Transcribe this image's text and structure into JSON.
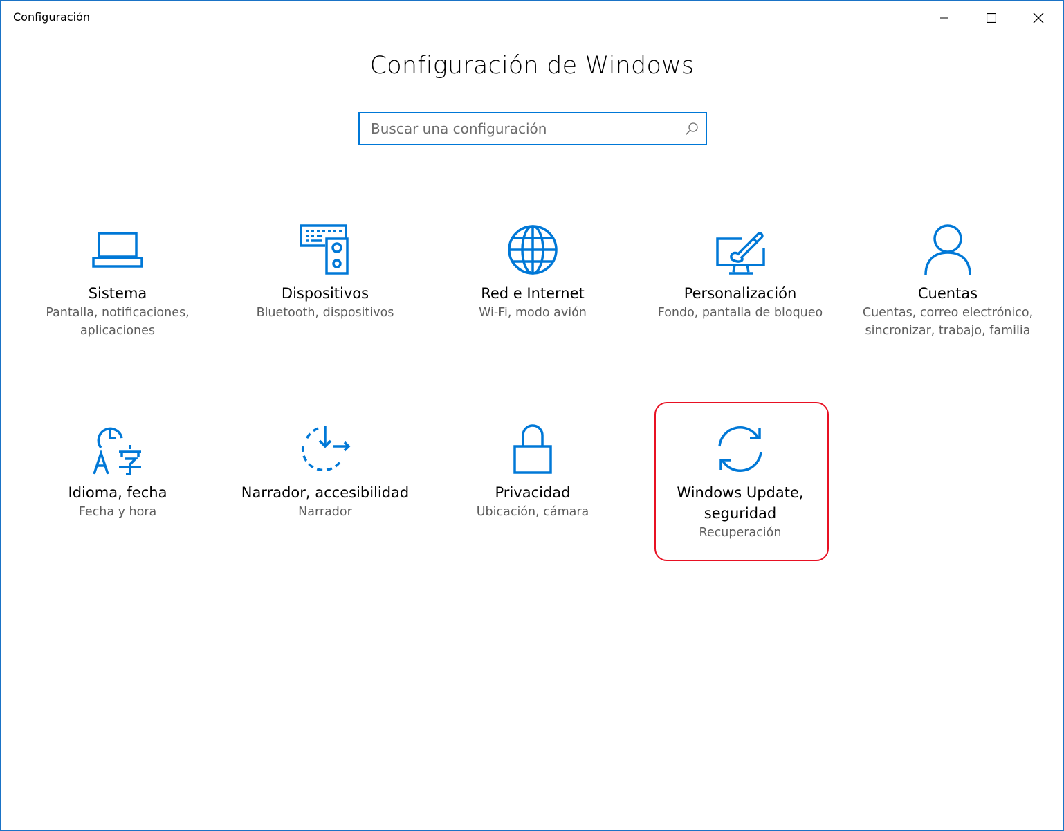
{
  "window": {
    "app_title": "Configuración",
    "accent_color": "#0078d7"
  },
  "header": {
    "page_title": "Configuración de Windows"
  },
  "search": {
    "placeholder": "Buscar una configuración",
    "value": ""
  },
  "tiles": [
    {
      "label": "Sistema",
      "desc": "Pantalla, notificaciones, aplicaciones",
      "icon": "laptop-icon"
    },
    {
      "label": "Dispositivos",
      "desc": "Bluetooth, dispositivos",
      "icon": "devices-icon"
    },
    {
      "label": "Red e Internet",
      "desc": "Wi-Fi, modo avión",
      "icon": "globe-icon"
    },
    {
      "label": "Personalización",
      "desc": "Fondo, pantalla de bloqueo",
      "icon": "paintbrush-icon"
    },
    {
      "label": "Cuentas",
      "desc": "Cuentas, correo electrónico, sincronizar, trabajo, familia",
      "icon": "person-icon"
    },
    {
      "label": "Idioma, fecha",
      "desc": "Fecha y hora",
      "icon": "language-clock-icon"
    },
    {
      "label": "Narrador, accesibilidad",
      "desc": "Narrador",
      "icon": "ease-of-access-icon"
    },
    {
      "label": "Privacidad",
      "desc": "Ubicación, cámara",
      "icon": "lock-icon"
    },
    {
      "label": "Windows Update, seguridad",
      "desc": "Recuperación",
      "icon": "sync-icon"
    }
  ],
  "highlight_color": "#e81123"
}
